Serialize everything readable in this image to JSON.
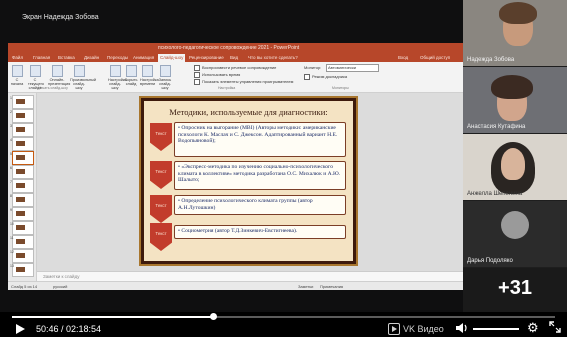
{
  "share": {
    "title": "Экран Надежда Зобова"
  },
  "ppt": {
    "window_title": "психолого-педагогическое сопровождение 2021 - PowerPoint",
    "tabs": [
      "Файл",
      "Главная",
      "Вставка",
      "Дизайн",
      "Переходы",
      "Анимация",
      "Слайд-шоу",
      "Рецензирование",
      "Вид",
      "Что вы хотите сделать?"
    ],
    "active_tab": "Слайд-шоу",
    "right_tabs": [
      "Вход",
      "Общий доступ"
    ],
    "ribbon_buttons": [
      "С начала",
      "С текущего слайда",
      "Онлайн-презентация",
      "Произвольный слайд-шоу",
      "Настройка слайд-шоу",
      "Скрыть слайд",
      "Настройка времени",
      "Запись слайд-шоу"
    ],
    "ribbon_checks": [
      "Воспроизвести речевое сопровождение",
      "Использовать время",
      "Показать элементы управления проигрывателем"
    ],
    "monitor_label": "Монитор:",
    "monitor_value": "Автоматически",
    "presenter_view": "Режим докладчика",
    "groups": [
      "Начать слайд-шоу",
      "Настройка",
      "Мониторы"
    ],
    "thumbs": [
      "1",
      "2",
      "3",
      "4",
      "5",
      "6",
      "7",
      "8",
      "9",
      "10",
      "11",
      "12",
      "13",
      "14"
    ],
    "notes_placeholder": "Заметки к слайду",
    "status_left": "Слайд 5 из 14",
    "status_lang": "русский",
    "status_notes": "Заметки",
    "status_comments": "Примечания"
  },
  "slide": {
    "title": "Методики, используемые для диагностики:",
    "label": "Текст",
    "items": [
      "Опросник на выгорание (МВI) (Авторы методики: американские психологи К. Маслач и С. Джексон. Адаптированный вариант Н.Е. Водопьяновой);",
      "«Экспресс-методика по изучению социально-психологического климата в коллективе» методика разработана О.С. Михалюк и А.Ю. Шалыто;",
      "Определение психологического климата группы (автор А.Н.Лутошкин)",
      "Социометрия (автор Т.Д.Зинкевич-Евстигнеева)."
    ]
  },
  "participants": [
    {
      "name": "Надежда Зобова"
    },
    {
      "name": "Анастасия Кутафина"
    },
    {
      "name": "Анжелла Шепенина"
    },
    {
      "name": "Дарья Подоляко"
    }
  ],
  "more_count": "+31",
  "player": {
    "current_time": "50:46",
    "duration": "02:18:54",
    "time_text": "50:46 / 02:18:54",
    "progress": 0.37,
    "source_label": "VK Видео",
    "volume": 1.0
  }
}
